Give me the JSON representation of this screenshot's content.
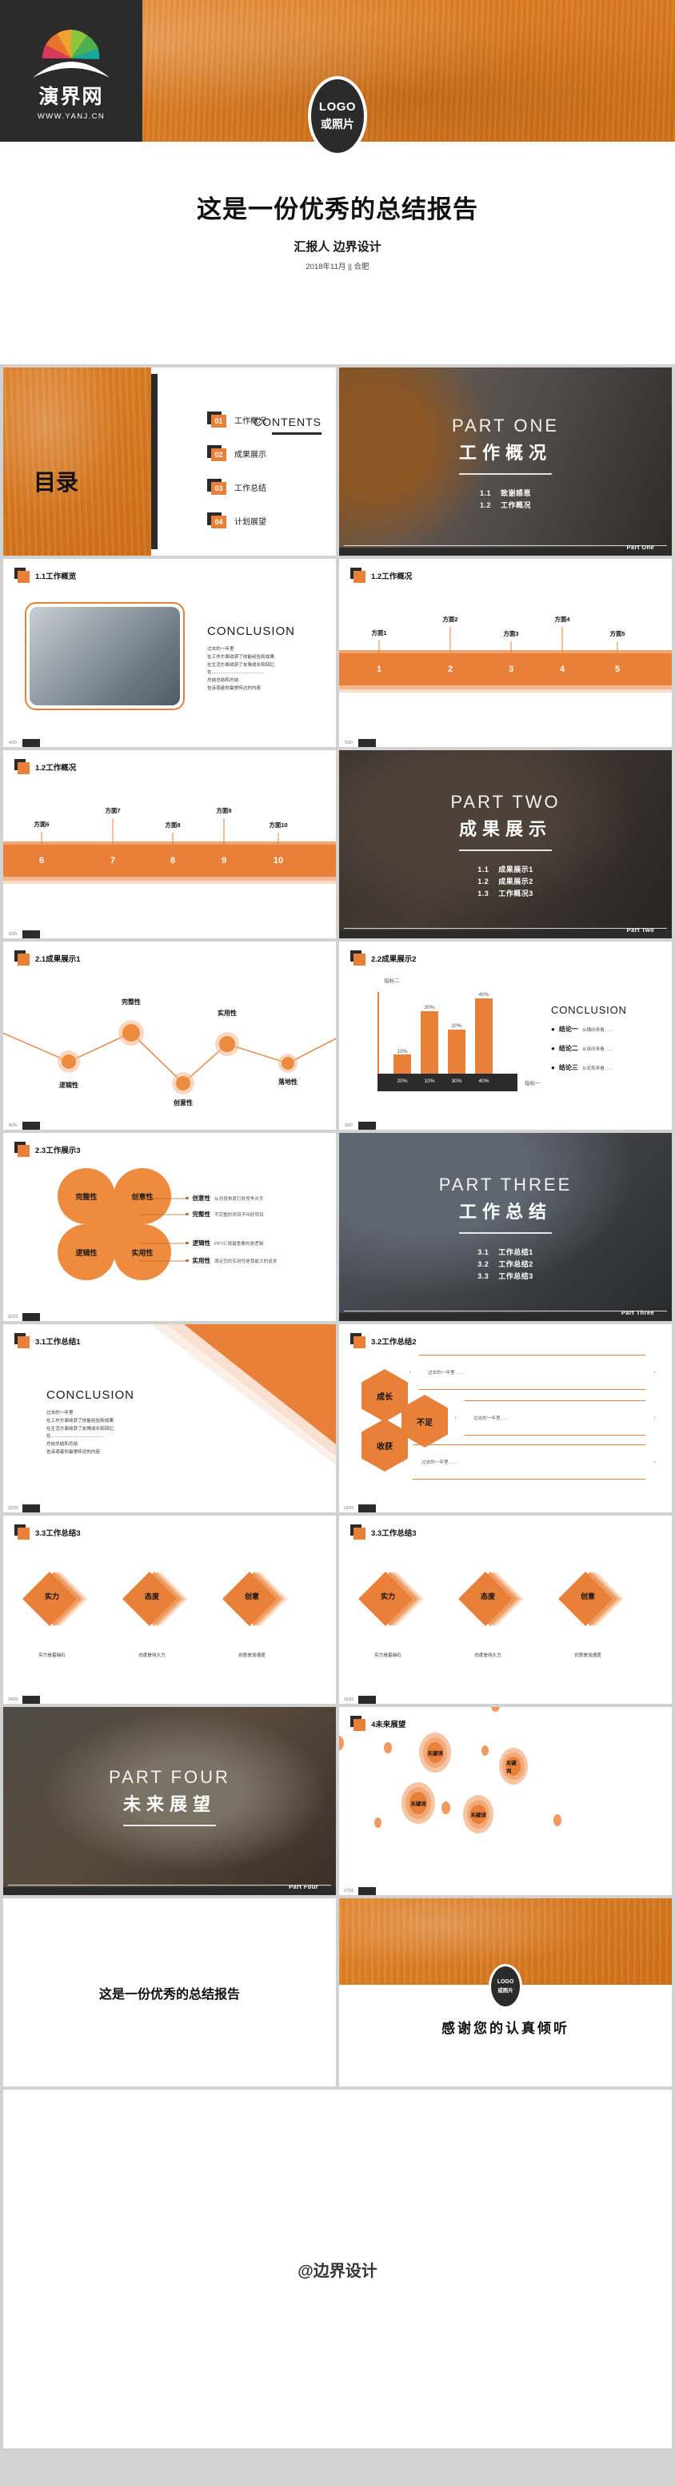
{
  "brand": {
    "name": "演界网",
    "url": "WWW.YANJ.CN",
    "logo_line1": "LOGO",
    "logo_line2": "或照片"
  },
  "cover": {
    "title": "这是一份优秀的总结报告",
    "presenter": "汇报人 边界设计",
    "meta": "2018年11月 || 合肥"
  },
  "toc": {
    "en_title": "CONTENTS",
    "cn_title": "目录",
    "items": [
      {
        "num": "01",
        "label": "工作概况"
      },
      {
        "num": "02",
        "label": "成果展示"
      },
      {
        "num": "03",
        "label": "工作总结"
      },
      {
        "num": "04",
        "label": "计划展望"
      }
    ]
  },
  "parts": [
    {
      "en": "PART ONE",
      "cn": "工作概况",
      "tag": "Part One",
      "bullets": [
        {
          "no": "1.1",
          "label": "致谢感恩"
        },
        {
          "no": "1.2",
          "label": "工作概况"
        }
      ]
    },
    {
      "en": "PART TWO",
      "cn": "成果展示",
      "tag": "Part Two",
      "bullets": [
        {
          "no": "1.1",
          "label": "成果展示1"
        },
        {
          "no": "1.2",
          "label": "成果展示2"
        },
        {
          "no": "1.3",
          "label": "工作概况3"
        }
      ]
    },
    {
      "en": "PART THREE",
      "cn": "工作总结",
      "tag": "Part Three",
      "bullets": [
        {
          "no": "3.1",
          "label": "工作总结1"
        },
        {
          "no": "3.2",
          "label": "工作总结2"
        },
        {
          "no": "3.3",
          "label": "工作总结3"
        }
      ]
    },
    {
      "en": "PART FOUR",
      "cn": "未来展望",
      "tag": "Part Four",
      "bullets": []
    }
  ],
  "conclusion": {
    "heading": "CONCLUSION",
    "body": "过去的一年里\n在工作方面收获了技能经验和成果;\n在生活方面收获了友情成长和回忆;\n在..........................................\n总结总结和总结\n告诉观者你最想传达的内容"
  },
  "slides": {
    "s4": {
      "title": "1.1工作概览",
      "page": "4/20"
    },
    "s5": {
      "title": "1.2工作概况",
      "page": "5/20",
      "numbers": [
        "1",
        "2",
        "3",
        "4",
        "5"
      ],
      "labels": [
        "方面1",
        "方面2",
        "方面3",
        "方面4",
        "方面5"
      ]
    },
    "s6": {
      "title": "1.2工作概况",
      "page": "6/20",
      "numbers": [
        "6",
        "7",
        "8",
        "9",
        "10"
      ],
      "labels": [
        "方面6",
        "方面7",
        "方面8",
        "方面9",
        "方面10"
      ]
    },
    "s8": {
      "title": "2.1成果展示1",
      "page": "8/20"
    },
    "s9": {
      "title": "2.2成果展示2",
      "page": "9/20"
    },
    "s10": {
      "title": "2.3工作展示3",
      "page": "10/20",
      "petals": [
        "完整性",
        "创意性",
        "逻辑性",
        "实用性"
      ],
      "legend": [
        {
          "k": "创意性",
          "v": "从创意角度打败竞争对手"
        },
        {
          "k": "完整性",
          "v": "不完整的项目不叫好项目"
        },
        {
          "k": "逻辑性",
          "v": "PPT汇报最重要的是逻辑"
        },
        {
          "k": "实用性",
          "v": "满足您的实用性是我最大的追求"
        }
      ]
    },
    "s12": {
      "title": "3.1工作总结1",
      "page": "12/20"
    },
    "s13": {
      "title": "3.2工作总结2",
      "page": "13/20",
      "hexes": [
        "成长",
        "不足",
        "收获"
      ],
      "bars": [
        "过去的一年里……",
        "过去的一年里……",
        "过去的一年里……"
      ]
    },
    "s14": {
      "title": "3.3工作总结3",
      "page": "14/20",
      "diamonds": [
        {
          "label": "实力",
          "caption": "实力是基础石"
        },
        {
          "label": "态度",
          "caption": "态度是持久力"
        },
        {
          "label": "创意",
          "caption": "创意是加速度"
        }
      ]
    },
    "s15": {
      "title": "3.3工作总结3",
      "page": "15/20",
      "diamonds": [
        {
          "label": "实力",
          "caption": "实力是基础石"
        },
        {
          "label": "态度",
          "caption": "态度是持久力"
        },
        {
          "label": "创意",
          "caption": "创意是加速度"
        }
      ]
    },
    "s17": {
      "title": "4未来展望",
      "page": "17/20",
      "keyword": "关键词"
    }
  },
  "ending": {
    "left_title": "这是一份优秀的总结报告",
    "thanks": "感谢您的认真倾听",
    "credit": "@边界设计"
  },
  "colors": {
    "accent": "#e8803a",
    "dark": "#2b2b2b",
    "light_accent": "#f3b892"
  },
  "chart_data": [
    {
      "type": "line",
      "title": "2.1成果展示1",
      "categories": [
        "逻辑性",
        "完整性",
        "创意性",
        "实用性",
        "落地性"
      ],
      "values": [
        42,
        72,
        22,
        62,
        38
      ],
      "xlabel": "",
      "ylabel": "",
      "ylim": [
        0,
        100
      ],
      "grid": false,
      "legend": "none"
    },
    {
      "type": "bar",
      "title": "2.2成果展示2",
      "categories": [
        "20%",
        "10%",
        "30%",
        "40%"
      ],
      "values": [
        10,
        30,
        20,
        40
      ],
      "data_labels": [
        "10%",
        "30%",
        "20%",
        "40%"
      ],
      "xlabel": "指标一",
      "ylabel": "指标二",
      "ylim": [
        0,
        50
      ],
      "grid": false,
      "legend": "none"
    }
  ]
}
